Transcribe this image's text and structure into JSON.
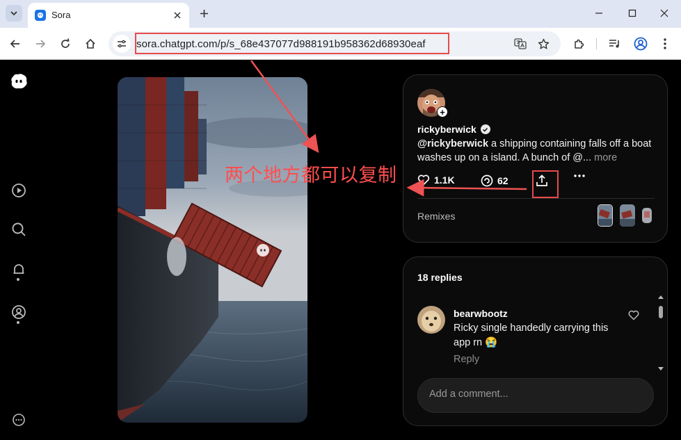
{
  "browser": {
    "tab_title": "Sora",
    "url": "sora.chatgpt.com/p/s_68e437077d988191b958362d68930eaf"
  },
  "post": {
    "username": "rickyberwick",
    "caption_mention": "@rickyberwick",
    "caption_text": " a shipping containing falls off a boat washes up on a island. A bunch of @...",
    "caption_more": " more",
    "likes": "1.1K",
    "remixes_count": "62",
    "remixes_label": "Remixes"
  },
  "replies": {
    "title": "18 replies",
    "items": [
      {
        "user": "bearwbootz",
        "text": "Ricky single handedly carrying this app rn 😭",
        "reply_label": "Reply"
      }
    ],
    "comment_placeholder": "Add a comment..."
  },
  "annotation": {
    "text": "两个地方都可以复制",
    "color": "#ff4e4e"
  },
  "colors": {
    "background": "#000000",
    "card": "#0b0b0b",
    "highlight": "#e84a4a",
    "chrome_tabbar": "#dfe5f2"
  }
}
